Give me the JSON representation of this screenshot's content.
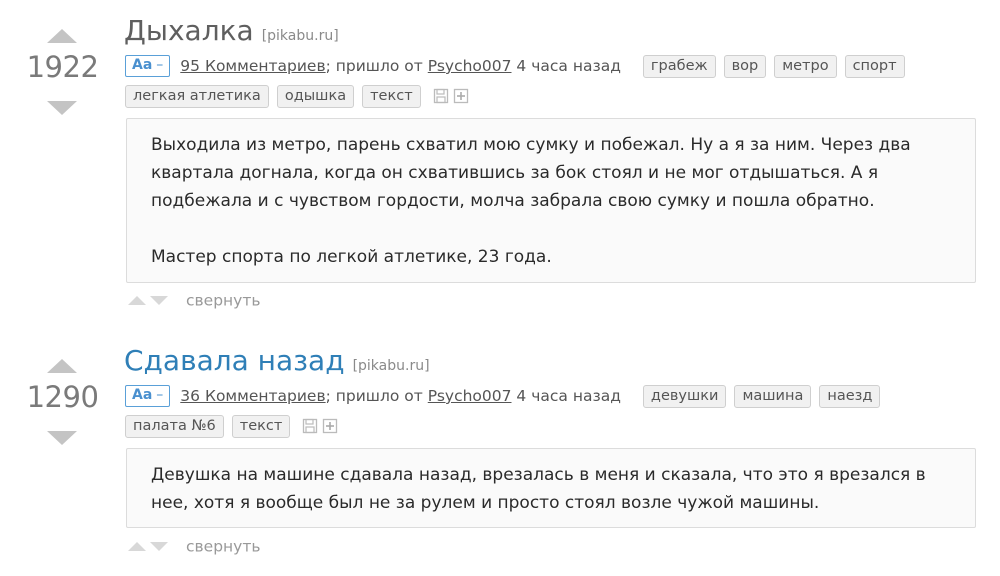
{
  "posts": [
    {
      "rating": "1922",
      "title": "Дыхалка",
      "source": "[pikabu.ru]",
      "font_toggle": "Aa",
      "font_toggle_dash": "–",
      "comments": "95 Комментариев",
      "came_from": "; пришло от ",
      "author": "Psycho007",
      "time": " 4 часа назад",
      "tags_row1": [
        "грабеж",
        "вор",
        "метро",
        "спорт"
      ],
      "tags_row2": [
        "легкая атлетика",
        "одышка",
        "текст"
      ],
      "icons": [
        "save-icon",
        "plus-icon"
      ],
      "paragraphs": [
        "Выходила из метро, парень схватил мою сумку и побежал. Ну а я за ним. Через два квартала догнала, когда он схватившись за бок стоял и не мог отдышаться. А я подбежала и с чувством гордости, молча забрала свою сумку и пошла обратно.",
        "Мастер спорта по легкой атлетике, 23 года."
      ],
      "collapse": "свернуть"
    },
    {
      "rating": "1290",
      "title": "Сдавала назад",
      "source": "[pikabu.ru]",
      "font_toggle": "Aa",
      "font_toggle_dash": "–",
      "comments": "36 Комментариев",
      "came_from": "; пришло от ",
      "author": "Psycho007",
      "time": " 4 часа назад",
      "tags_row1": [
        "девушки",
        "машина",
        "наезд"
      ],
      "tags_row2": [
        "палата №6",
        "текст"
      ],
      "icons": [
        "save-icon",
        "plus-icon"
      ],
      "paragraphs": [
        "Девушка на машине сдавала назад, врезалась в меня и сказала, что это я врезался в нее, хотя я вообще был не за рулем и просто стоял возле чужой машины."
      ],
      "collapse": "свернуть"
    }
  ],
  "colors": {
    "title_visited": "#5f5f5f",
    "title_link": "#2f7fb7",
    "accent_blue": "#4a90cf",
    "arrow_gray": "#c4c4c4"
  }
}
